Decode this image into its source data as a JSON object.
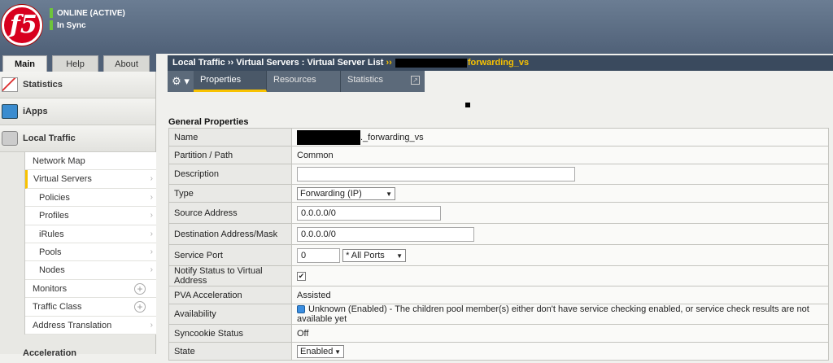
{
  "header": {
    "logo_text": "f5",
    "status_online": "ONLINE (ACTIVE)",
    "status_sync": "In Sync"
  },
  "left_tabs": {
    "main": "Main",
    "help": "Help",
    "about": "About"
  },
  "nav": {
    "statistics": "Statistics",
    "iapps": "iApps",
    "local_traffic": "Local Traffic",
    "items": [
      {
        "label": "Network Map",
        "kind": "item"
      },
      {
        "label": "Virtual Servers",
        "kind": "item",
        "active": true,
        "chevron": "›"
      },
      {
        "label": "Policies",
        "kind": "sub",
        "chevron": "›"
      },
      {
        "label": "Profiles",
        "kind": "sub",
        "chevron": "›"
      },
      {
        "label": "iRules",
        "kind": "sub",
        "chevron": "›"
      },
      {
        "label": "Pools",
        "kind": "sub",
        "chevron": "›"
      },
      {
        "label": "Nodes",
        "kind": "sub",
        "chevron": "›"
      },
      {
        "label": "Monitors",
        "kind": "item",
        "plus": "+"
      },
      {
        "label": "Traffic Class",
        "kind": "item",
        "plus": "+"
      },
      {
        "label": "Address Translation",
        "kind": "item",
        "chevron": "›"
      }
    ],
    "acceleration": "Acceleration"
  },
  "breadcrumb": {
    "part1": "Local Traffic",
    "sep1": "››",
    "part2": "Virtual Servers : Virtual Server List",
    "sep2": "››",
    "current": "forwarding_vs"
  },
  "tabs": {
    "gear": "⚙ ▾",
    "properties": "Properties",
    "resources": "Resources",
    "statistics": "Statistics",
    "popout": "↗"
  },
  "section_title": "General Properties",
  "props": {
    "name_label": "Name",
    "name_value": "._forwarding_vs",
    "partition_label": "Partition / Path",
    "partition_value": "Common",
    "description_label": "Description",
    "description_value": "",
    "type_label": "Type",
    "type_value": "Forwarding (IP)",
    "source_label": "Source Address",
    "source_value": "0.0.0.0/0",
    "dest_label": "Destination Address/Mask",
    "dest_value": "0.0.0.0/0",
    "port_label": "Service Port",
    "port_value": "0",
    "port_select": "* All Ports",
    "notify_label": "Notify Status to Virtual Address",
    "notify_check": "✔",
    "pva_label": "PVA Acceleration",
    "pva_value": "Assisted",
    "avail_label": "Availability",
    "avail_value": "Unknown (Enabled)",
    "avail_detail": " - The children pool member(s) either don't have service checking enabled, or service check results are not available yet",
    "syncookie_label": "Syncookie Status",
    "syncookie_value": "Off",
    "state_label": "State",
    "state_value": "Enabled"
  },
  "colors": {
    "accent": "#f8c200",
    "header": "#506178",
    "online": "#6ec53a"
  }
}
